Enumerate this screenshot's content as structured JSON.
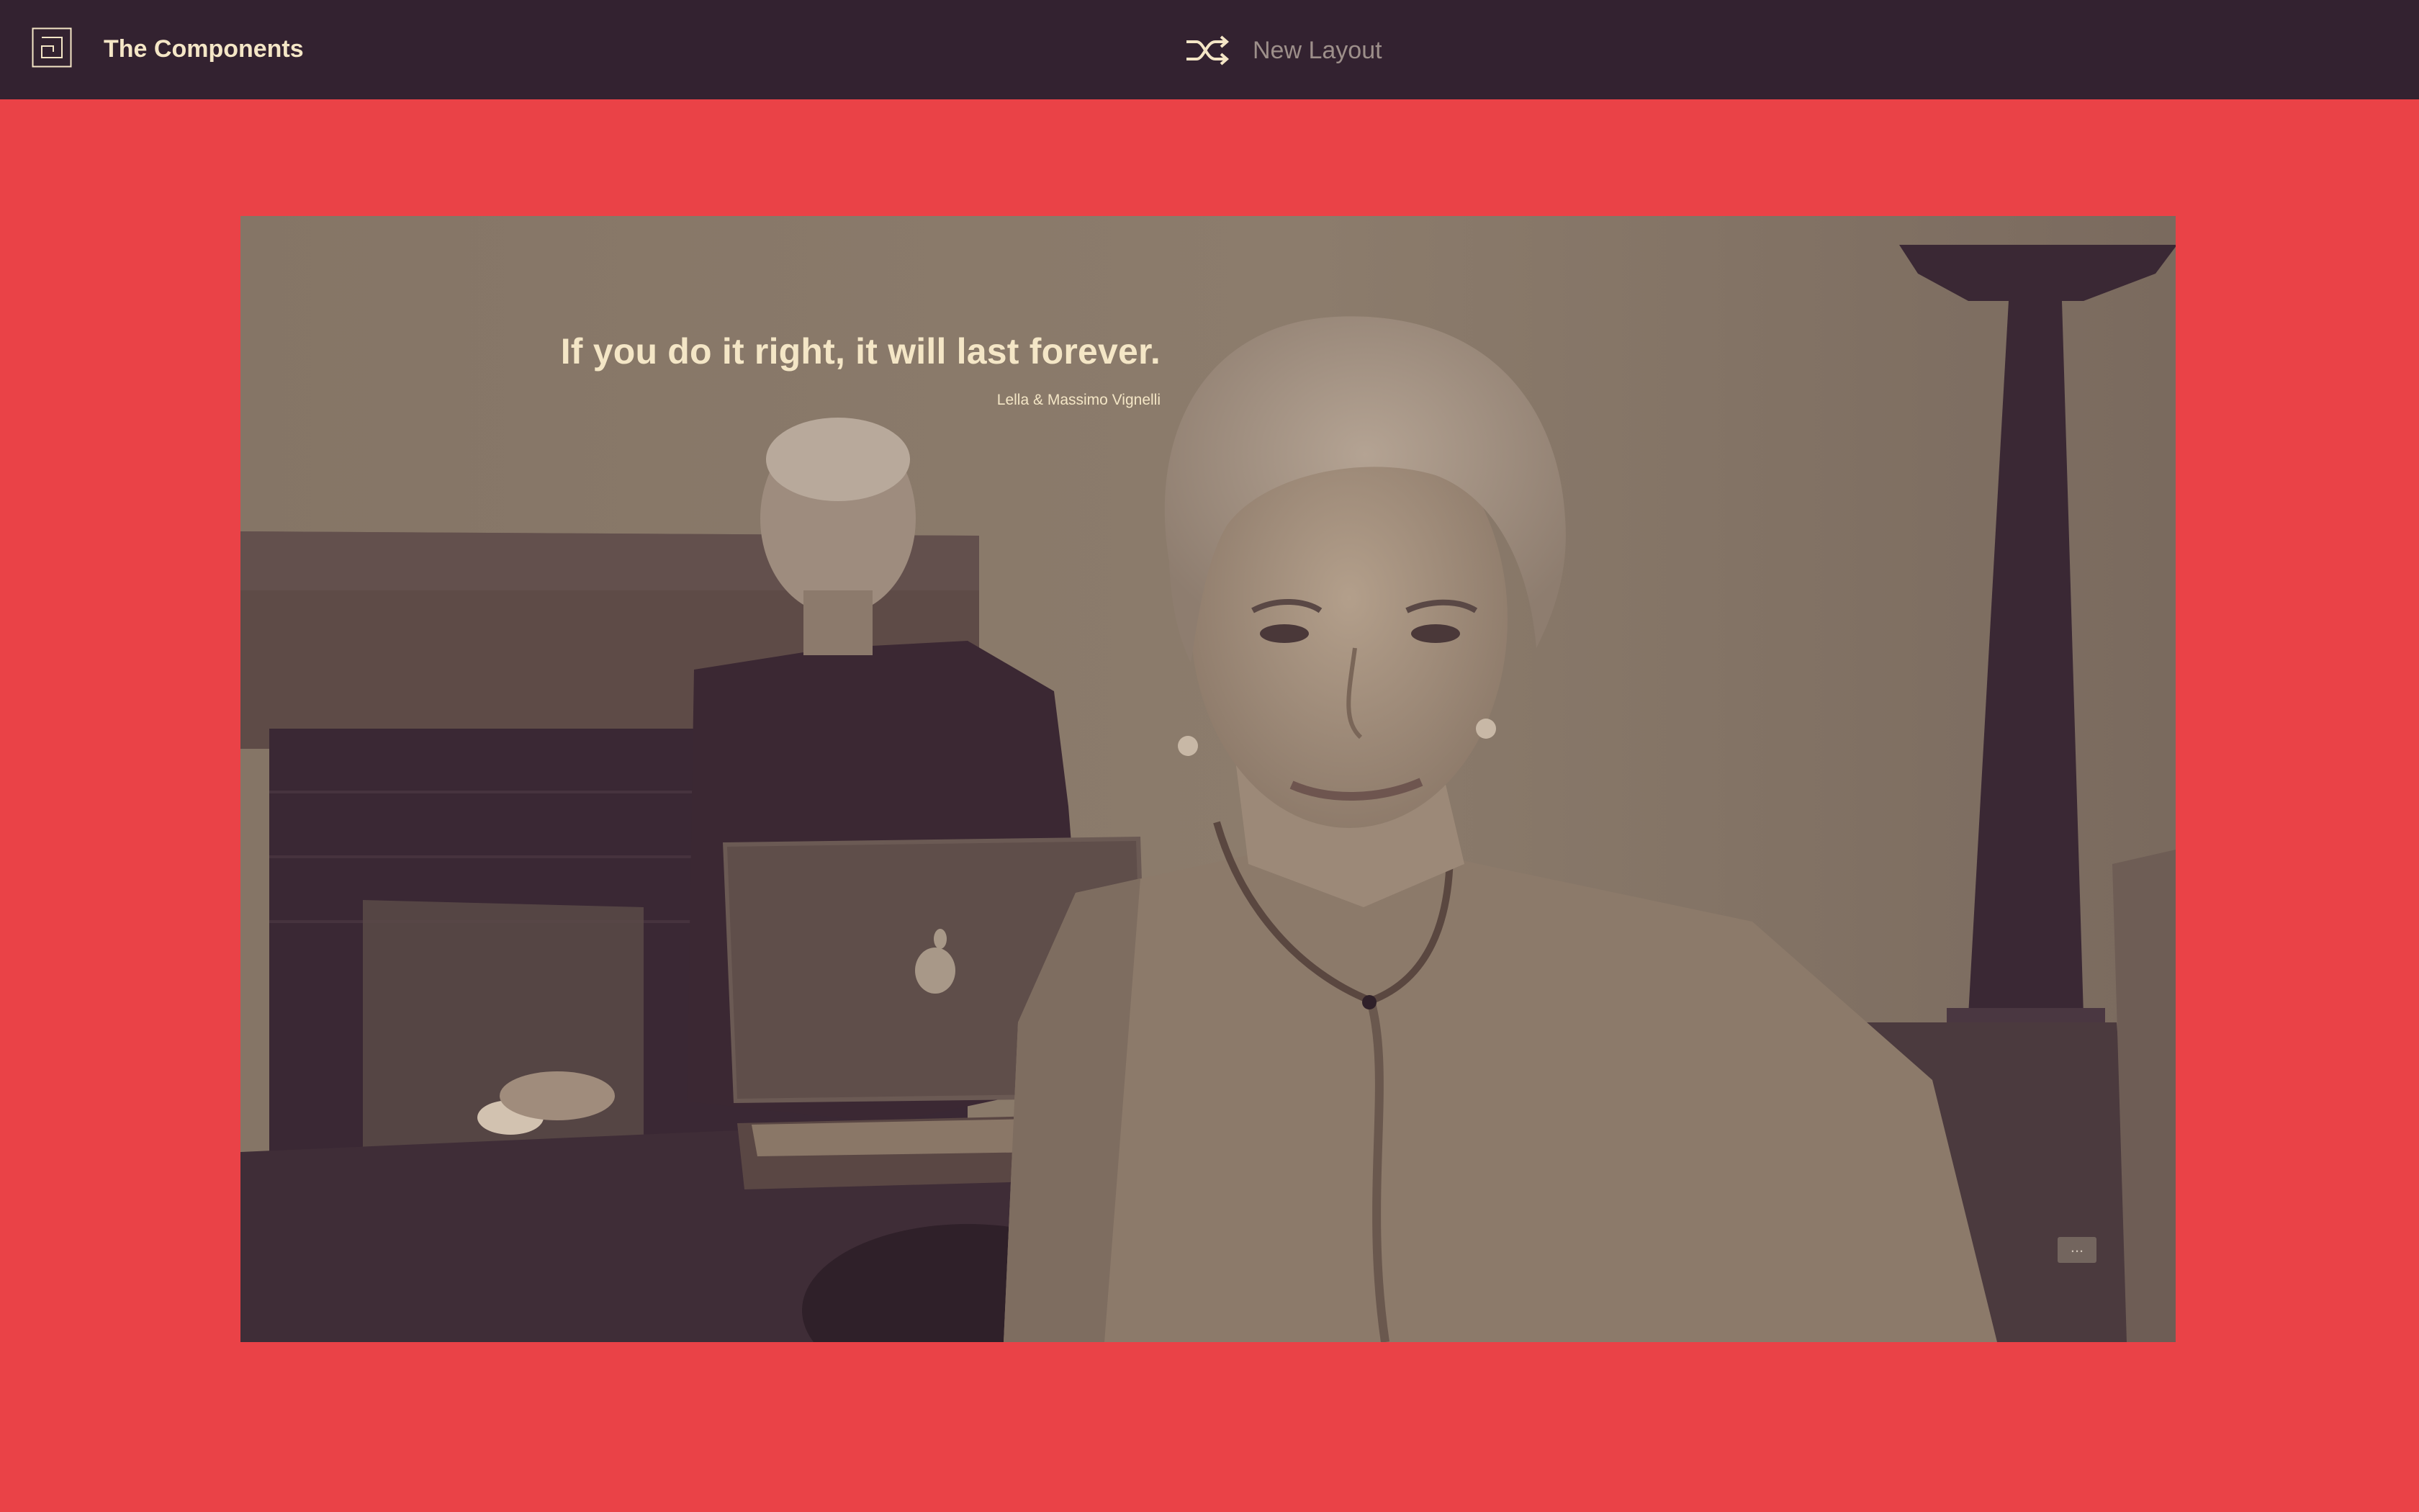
{
  "header": {
    "app_title": "The Components",
    "new_layout_label": "New Layout",
    "logo_icon": "grid-logo-icon",
    "shuffle_icon": "shuffle-icon"
  },
  "hero": {
    "quote": "If you do it right, it will last forever.",
    "author": "Lella & Massimo Vignelli",
    "more_label": "..."
  },
  "colors": {
    "page_background": "#ea4247",
    "topbar_background": "#332230",
    "accent_text": "#f4e6c6",
    "muted_text": "#9d8f8a"
  }
}
